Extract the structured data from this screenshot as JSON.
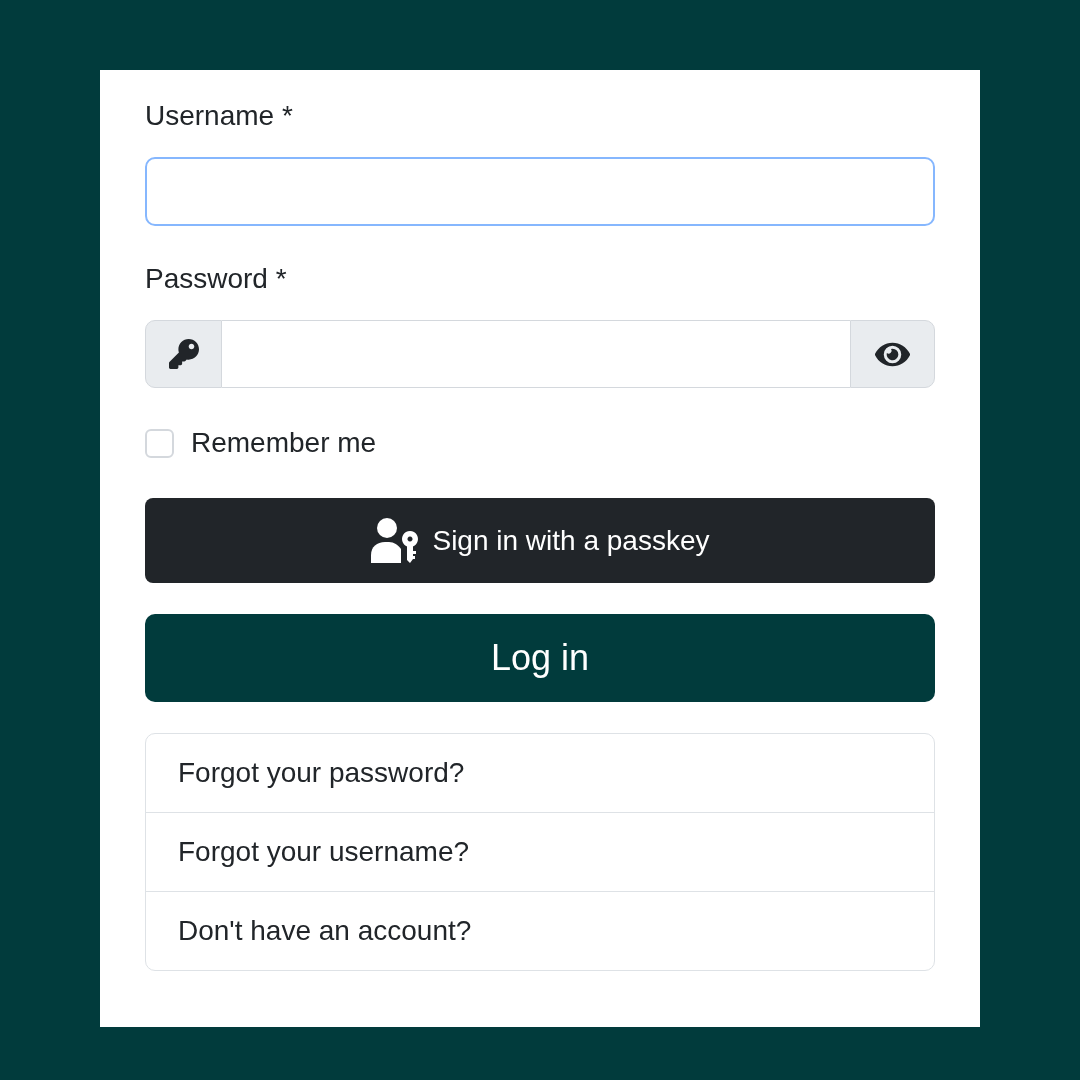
{
  "username": {
    "label": "Username *",
    "focused": true
  },
  "password": {
    "label": "Password *",
    "focused": false
  },
  "remember": {
    "label": "Remember me",
    "checked": false
  },
  "passkey_button": {
    "label": "Sign in with a passkey"
  },
  "login_button": {
    "label": "Log in"
  },
  "links": [
    "Forgot your password?",
    "Forgot your username?",
    "Don't have an account?"
  ]
}
